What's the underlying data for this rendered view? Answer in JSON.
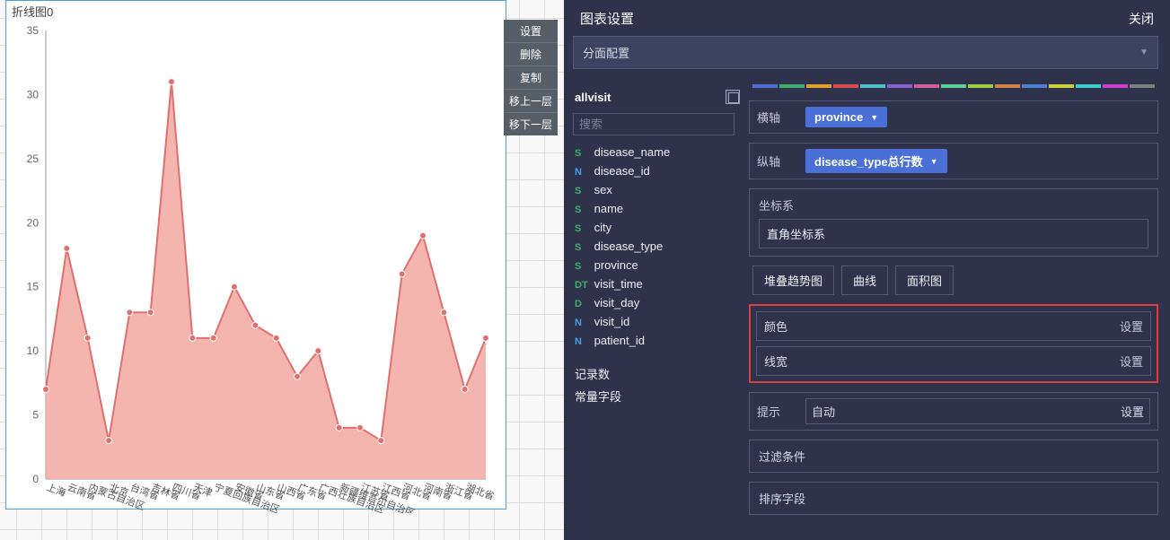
{
  "chart": {
    "title": "折线图0"
  },
  "context_menu": {
    "items": [
      "设置",
      "删除",
      "复制",
      "移上一层",
      "移下一层"
    ]
  },
  "panel": {
    "title": "图表设置",
    "close": "关闭",
    "facet_label": "分面配置",
    "datasource": {
      "name": "allvisit",
      "search_placeholder": "搜索",
      "fields": [
        {
          "type": "S",
          "name": "disease_name"
        },
        {
          "type": "N",
          "name": "disease_id"
        },
        {
          "type": "S",
          "name": "sex"
        },
        {
          "type": "S",
          "name": "name"
        },
        {
          "type": "S",
          "name": "city"
        },
        {
          "type": "S",
          "name": "disease_type"
        },
        {
          "type": "S",
          "name": "province"
        },
        {
          "type": "DT",
          "name": "visit_time"
        },
        {
          "type": "D",
          "name": "visit_day"
        },
        {
          "type": "N",
          "name": "visit_id"
        },
        {
          "type": "N",
          "name": "patient_id"
        }
      ],
      "meta": [
        "记录数",
        "常量字段"
      ]
    },
    "config": {
      "xaxis_label": "横轴",
      "xaxis_value": "province",
      "yaxis_label": "纵轴",
      "yaxis_value": "disease_type总行数",
      "coord_label": "坐标系",
      "coord_value": "直角坐标系",
      "chart_types": [
        "堆叠趋势图",
        "曲线",
        "面积图"
      ],
      "color_label": "颜色",
      "linewidth_label": "线宽",
      "set_label": "设置",
      "tooltip_label": "提示",
      "tooltip_value": "自动",
      "filter_label": "过滤条件",
      "sort_label": "排序字段"
    }
  },
  "chart_data": {
    "type": "area",
    "title": "折线图0",
    "xlabel": "",
    "ylabel": "",
    "ylim": [
      0,
      35
    ],
    "categories": [
      "上海",
      "云南省",
      "内蒙古自治区",
      "北京",
      "台湾省",
      "吉林省",
      "四川省",
      "天津",
      "宁夏回族自治区",
      "安徽省",
      "山东省",
      "山西省",
      "广东省",
      "广西壮族自治区",
      "新疆维吾尔自治区",
      "江苏省",
      "江西省",
      "河北省",
      "河南省",
      "浙江省",
      "湖北省"
    ],
    "values": [
      7,
      18,
      11,
      3,
      13,
      13,
      31,
      11,
      11,
      15,
      12,
      11,
      8,
      10,
      4,
      4,
      3,
      16,
      19,
      13,
      7,
      11
    ],
    "colors": {
      "line": "#e07070",
      "fill": "#f2a8a0"
    }
  }
}
